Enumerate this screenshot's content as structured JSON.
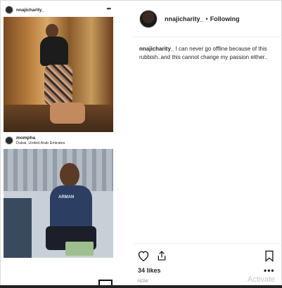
{
  "media": {
    "embed1": {
      "username": "nnajicharity_",
      "menu_icon": "ellipsis-icon"
    },
    "embed2": {
      "username": "mompha",
      "location": "Dubai, United Arab Emirates",
      "shirt_text": "ARMAN"
    }
  },
  "post": {
    "username": "nnajicharity_",
    "separator": "•",
    "follow_status": "Following",
    "caption_user": "nnajicharity_",
    "caption_text": " I can never go offline because of this rubbish..and this cannot change my passion either..",
    "likes": "34 likes",
    "time": "NOW",
    "more": "•••"
  },
  "watermark": "Activate",
  "icons": [
    "heart-icon",
    "share-icon",
    "bookmark-icon"
  ]
}
